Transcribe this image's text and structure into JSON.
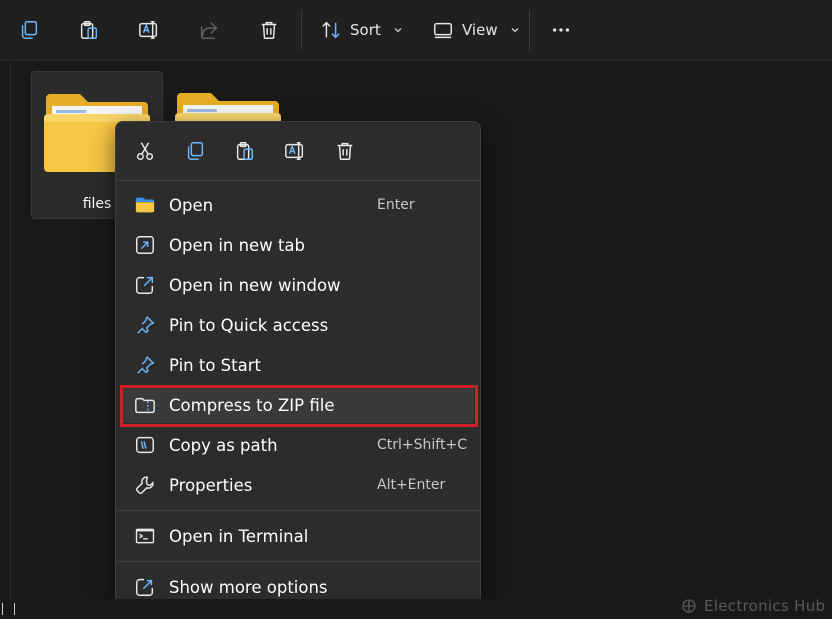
{
  "toolbar": {
    "sort_label": "Sort",
    "view_label": "View"
  },
  "files": [
    {
      "name": "files",
      "selected": true
    },
    {
      "name": "",
      "selected": false
    }
  ],
  "context_menu": {
    "items": [
      {
        "label": "Open",
        "shortcut": "Enter",
        "icon": "folder-icon"
      },
      {
        "label": "Open in new tab",
        "shortcut": "",
        "icon": "new-tab-icon"
      },
      {
        "label": "Open in new window",
        "shortcut": "",
        "icon": "new-window-icon"
      },
      {
        "label": "Pin to Quick access",
        "shortcut": "",
        "icon": "pin-icon"
      },
      {
        "label": "Pin to Start",
        "shortcut": "",
        "icon": "pin-icon"
      },
      {
        "label": "Compress to ZIP file",
        "shortcut": "",
        "icon": "zip-folder-icon"
      },
      {
        "label": "Copy as path",
        "shortcut": "Ctrl+Shift+C",
        "icon": "copy-path-icon"
      },
      {
        "label": "Properties",
        "shortcut": "Alt+Enter",
        "icon": "wrench-icon"
      },
      {
        "label": "Open in Terminal",
        "shortcut": "",
        "icon": "terminal-icon"
      },
      {
        "label": "Show more options",
        "shortcut": "",
        "icon": "share-icon"
      }
    ]
  },
  "watermark": {
    "text": "Electronics Hub"
  },
  "colors": {
    "highlight_border": "#d0202a",
    "menu_background": "#2c2c2c",
    "folder_yellow": "#f4c23a"
  }
}
